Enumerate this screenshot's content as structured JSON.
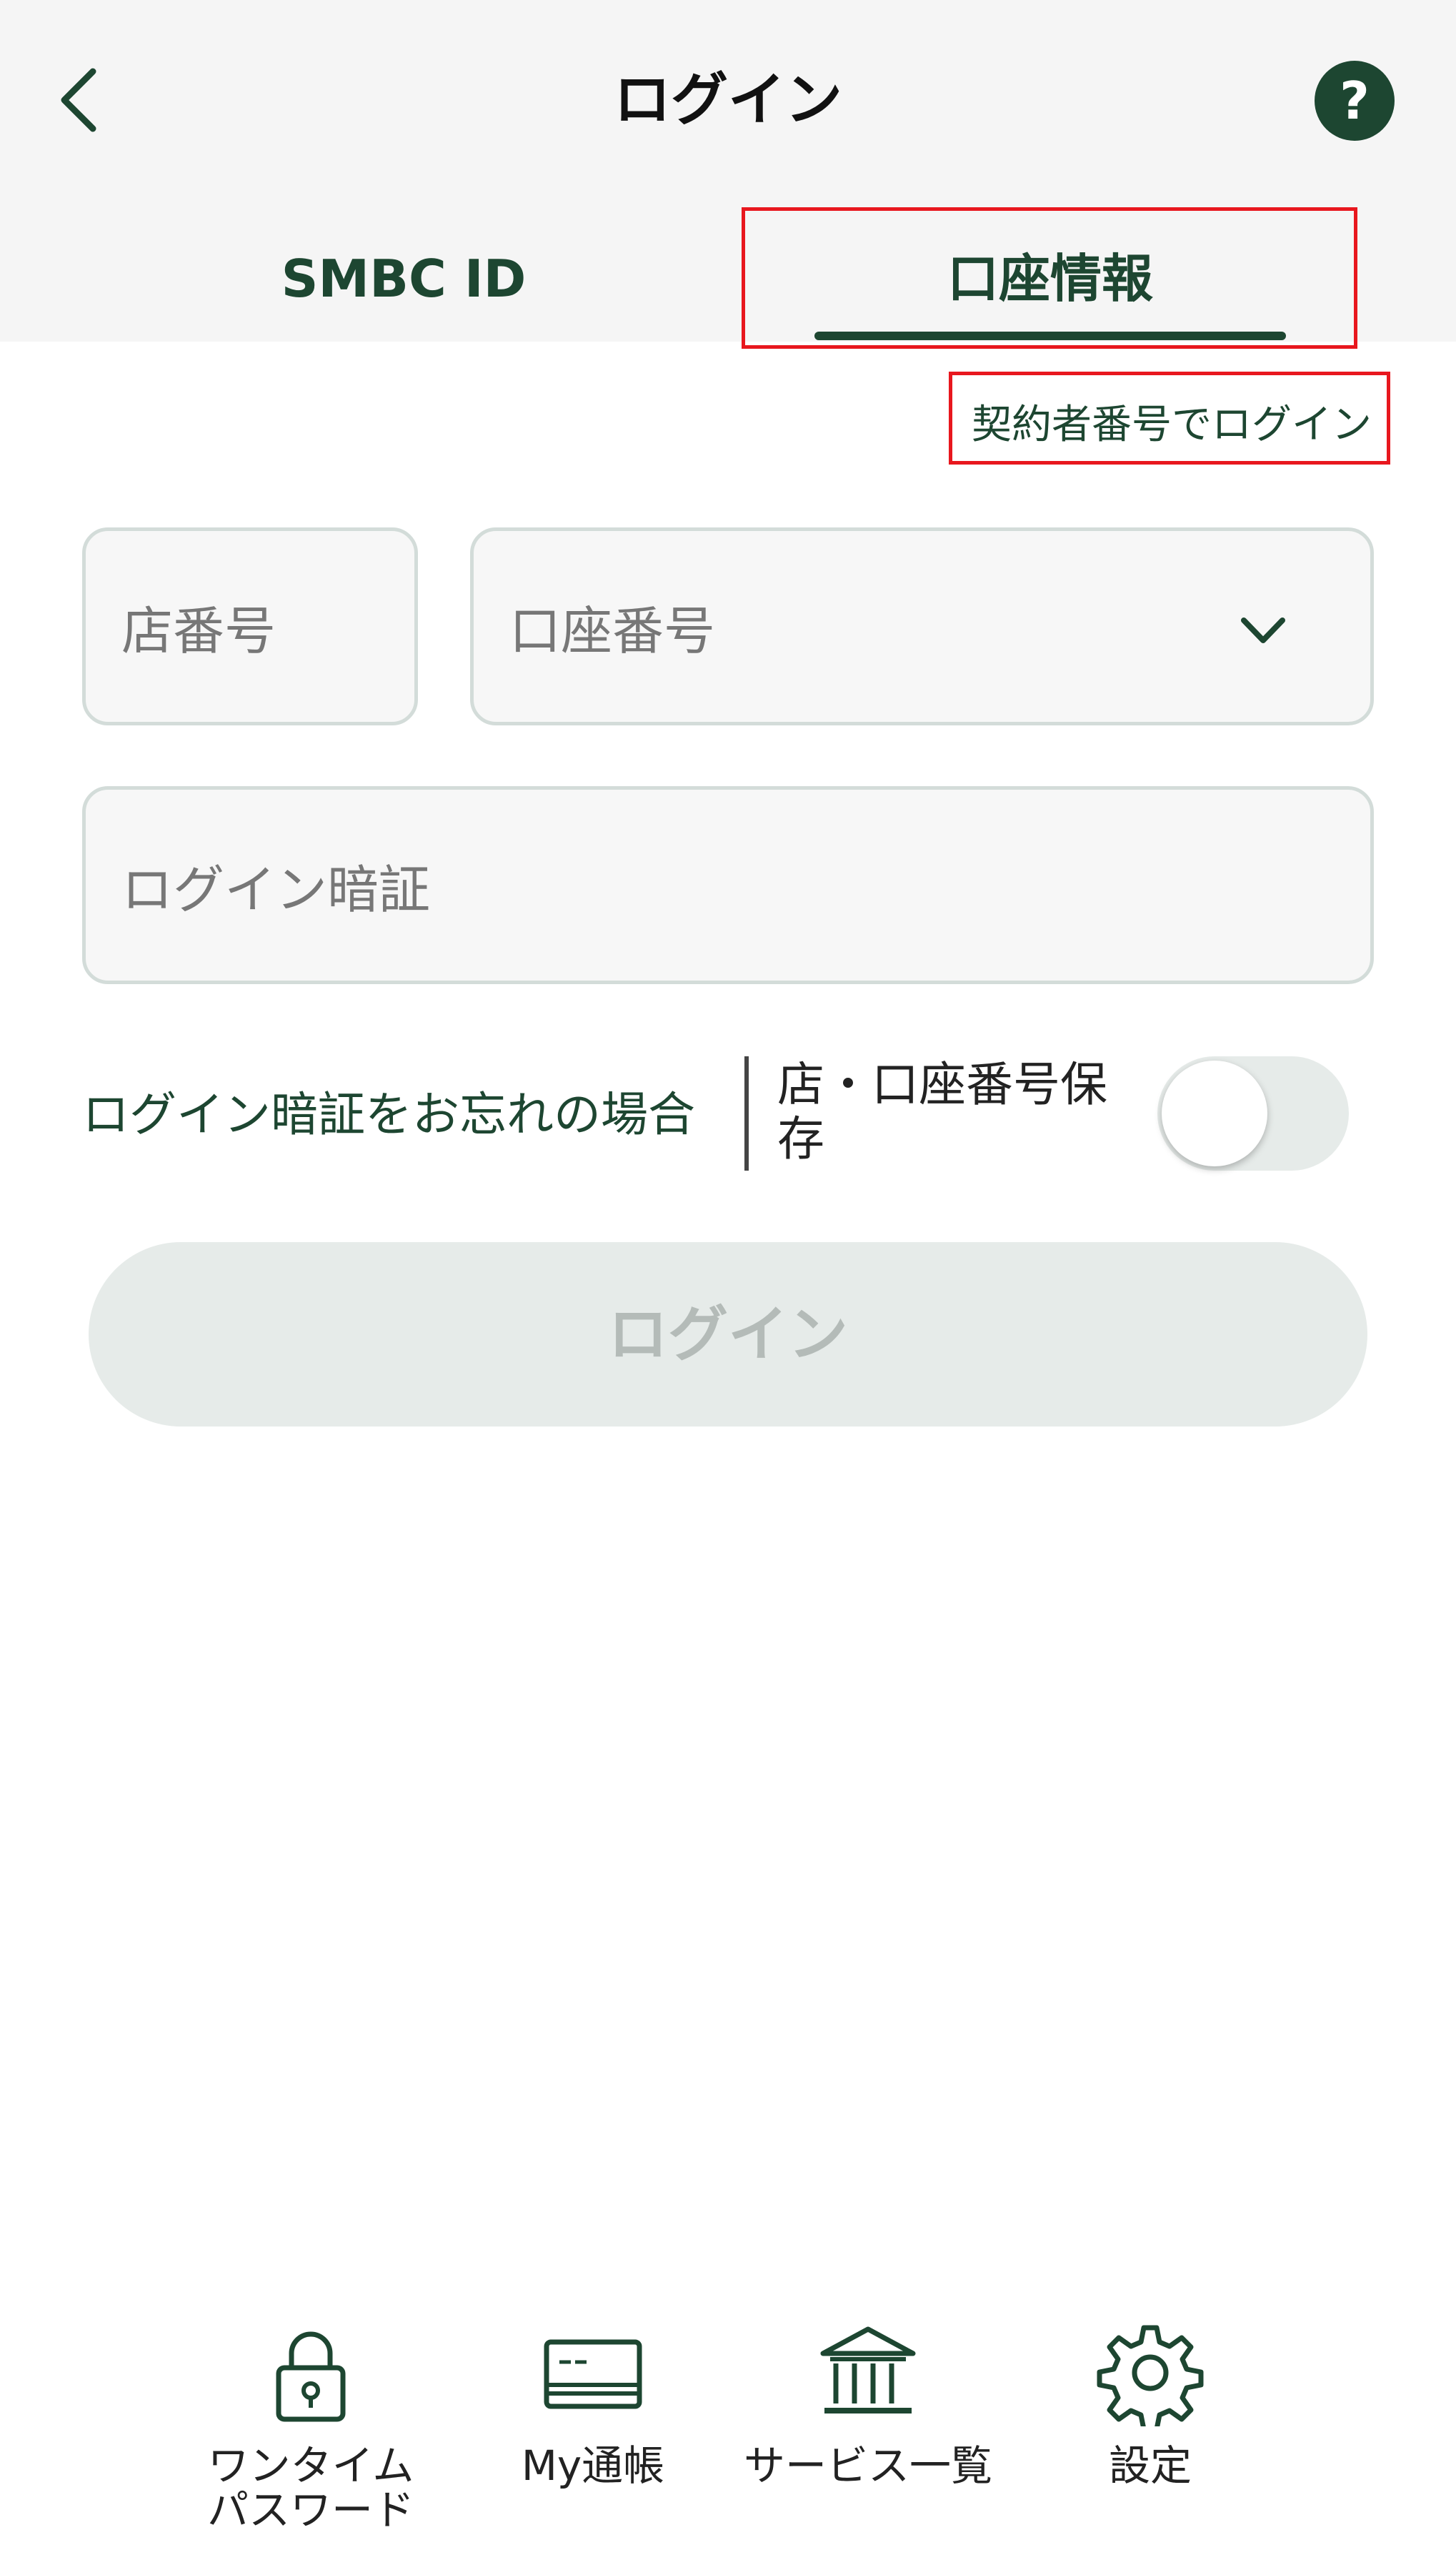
{
  "header": {
    "title": "ログイン",
    "back_icon": "chevron-left-icon",
    "help_label": "?"
  },
  "tabs": [
    {
      "label": "SMBC ID",
      "selected": false
    },
    {
      "label": "口座情報",
      "selected": true
    }
  ],
  "contract_login_link": "契約者番号でログイン",
  "form": {
    "branch_placeholder": "店番号",
    "account_placeholder": "口座番号",
    "password_placeholder": "ログイン暗証",
    "forgot_link": "ログイン暗証をお忘れの場合",
    "save_label": "店・口座番号保存",
    "save_toggle_on": false
  },
  "login_button": "ログイン",
  "bottom_nav": [
    {
      "label": "ワンタイム\nパスワード",
      "icon": "lock-icon"
    },
    {
      "label": "My通帳",
      "icon": "passbook-icon"
    },
    {
      "label": "サービス一覧",
      "icon": "bank-icon"
    },
    {
      "label": "設定",
      "icon": "gear-icon"
    }
  ],
  "colors": {
    "brand_green": "#1d4631",
    "highlight_red": "#e8171e",
    "disabled_bg": "#e6ebe9",
    "disabled_text": "#b4bbb8"
  }
}
